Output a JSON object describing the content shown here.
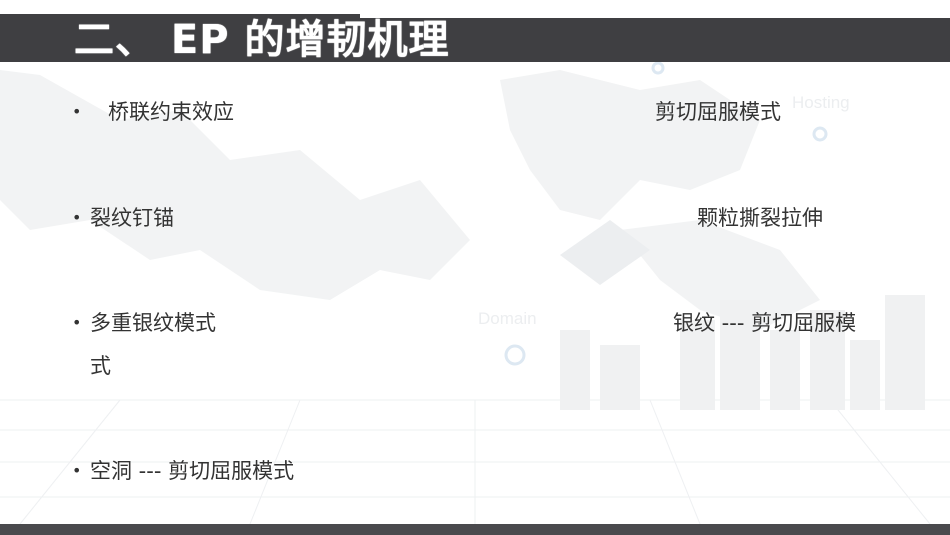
{
  "slide": {
    "title": "二、 EP 的增韧机理",
    "left_items": [
      "桥联约束效应",
      "裂纹钉锚",
      "多重银纹模式",
      "式",
      "空洞 --- 剪切屈服模式"
    ],
    "right_items": [
      "剪切屈服模式",
      "颗粒撕裂拉伸",
      "银纹 --- 剪切屈服模"
    ],
    "bullet_symbol": "•",
    "background_words": {
      "hosting": "Hosting",
      "domain": "Domain"
    }
  },
  "colors": {
    "title_bar": "#3f3f42",
    "text": "#333333",
    "background": "#ffffff"
  }
}
